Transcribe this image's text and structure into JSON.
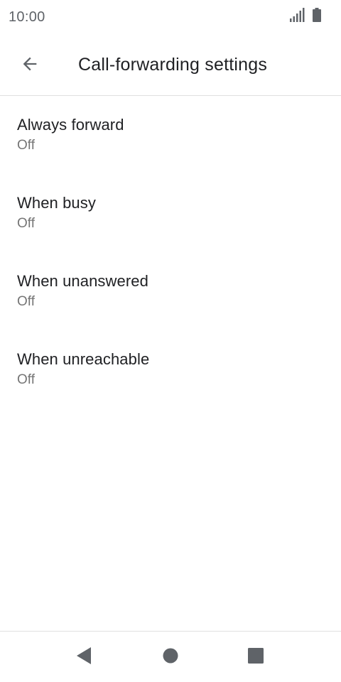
{
  "status_bar": {
    "time": "10:00",
    "icons": [
      "signal-icon",
      "battery-icon"
    ]
  },
  "app_bar": {
    "title": "Call-forwarding settings",
    "back_icon": "arrow-back-icon"
  },
  "settings": [
    {
      "title": "Always forward",
      "summary": "Off"
    },
    {
      "title": "When busy",
      "summary": "Off"
    },
    {
      "title": "When unanswered",
      "summary": "Off"
    },
    {
      "title": "When unreachable",
      "summary": "Off"
    }
  ],
  "nav_bar": {
    "buttons": [
      "nav-back-icon",
      "nav-home-icon",
      "nav-recents-icon"
    ]
  },
  "colors": {
    "text_primary": "#202124",
    "text_secondary": "#757575",
    "icon": "#5f6368",
    "divider": "#e0e0e0"
  }
}
